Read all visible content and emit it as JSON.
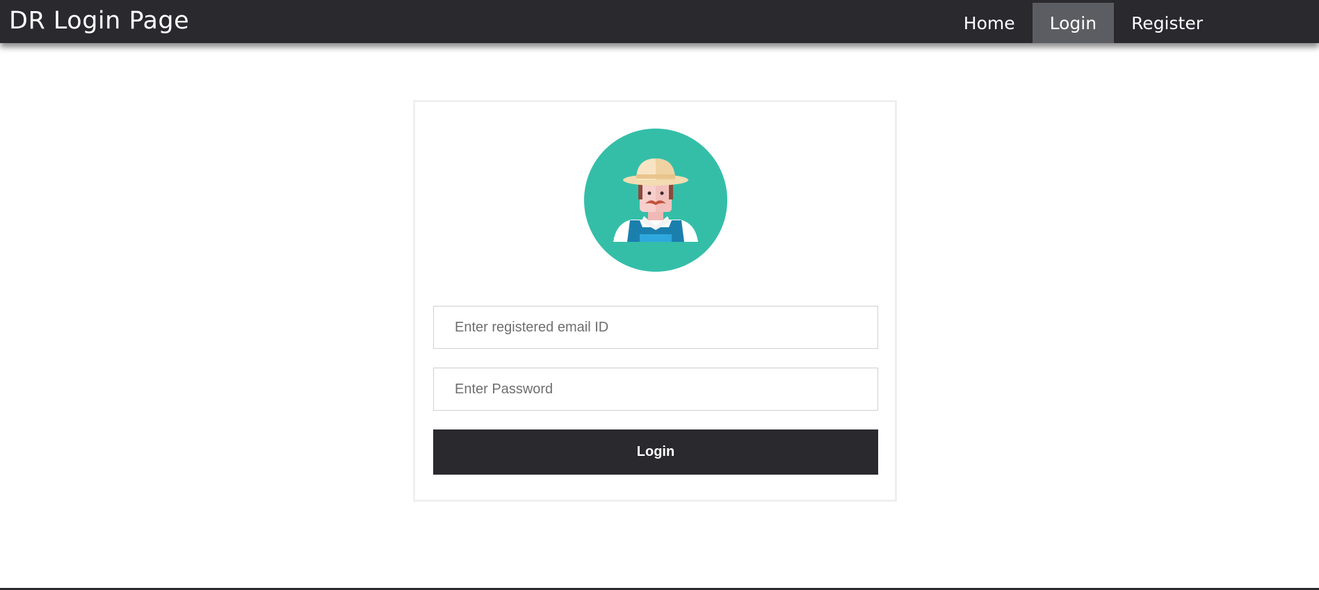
{
  "header": {
    "brand": "DR Login Page",
    "nav": [
      {
        "label": "Home",
        "active": false
      },
      {
        "label": "Login",
        "active": true
      },
      {
        "label": "Register",
        "active": false
      }
    ]
  },
  "login_form": {
    "avatar_icon": "farmer-avatar-icon",
    "email_placeholder": "Enter registered email ID",
    "email_value": "",
    "password_placeholder": "Enter Password",
    "password_value": "",
    "submit_label": "Login"
  },
  "colors": {
    "navbar": "#29292e",
    "nav_active": "#5b5d63",
    "avatar_bg": "#34bea8",
    "button": "#29292e"
  }
}
